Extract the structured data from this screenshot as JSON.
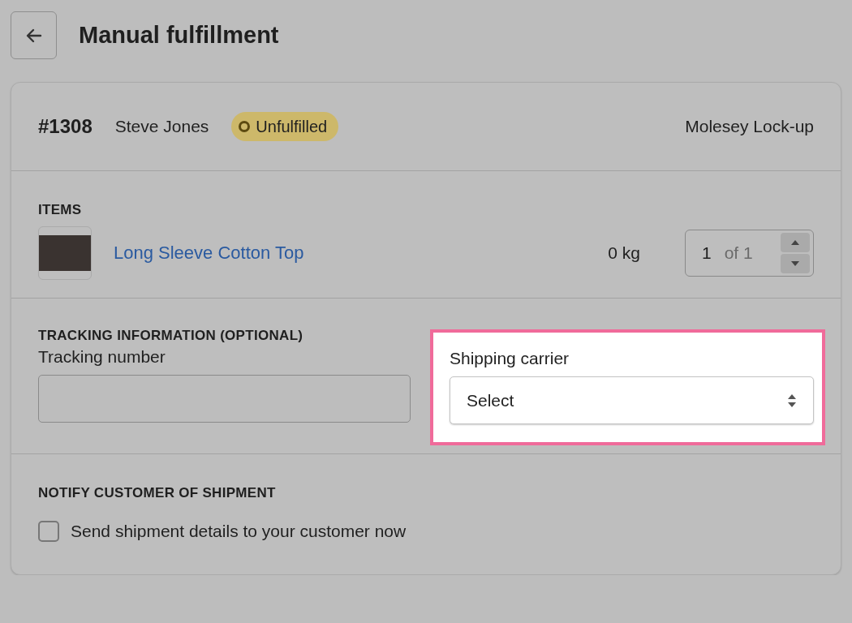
{
  "page": {
    "title": "Manual fulfillment"
  },
  "order": {
    "number": "#1308",
    "customer": "Steve Jones",
    "status": {
      "label": "Unfulfilled",
      "kind": "warning"
    },
    "location": "Molesey Lock-up"
  },
  "items_section": {
    "heading": "ITEMS",
    "items": [
      {
        "name": "Long Sleeve Cotton Top",
        "weight": "0 kg",
        "quantity": "1",
        "quantity_total": "of 1"
      }
    ]
  },
  "tracking_section": {
    "heading": "TRACKING INFORMATION (OPTIONAL)",
    "tracking_number": {
      "label": "Tracking number"
    },
    "shipping_carrier": {
      "label": "Shipping carrier",
      "value": "Select",
      "highlighted": true
    }
  },
  "notify_section": {
    "heading": "NOTIFY CUSTOMER OF SHIPMENT",
    "checkbox": {
      "label": "Send shipment details to your customer now",
      "checked": false
    }
  }
}
